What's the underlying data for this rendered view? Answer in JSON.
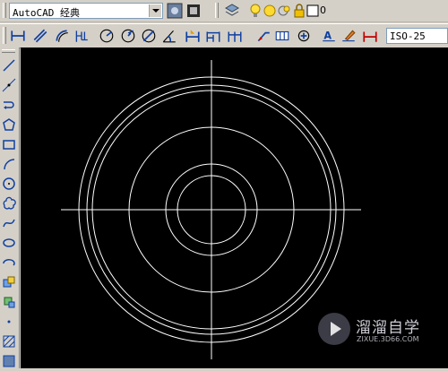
{
  "toolbar_top": {
    "workspace_value": "AutoCAD 经典",
    "layer_value": "0"
  },
  "toolbar_dim": {
    "dimstyle_value": "ISO-25"
  },
  "drawing": {
    "background": "#000000",
    "line_color": "#ffffff",
    "circle_count": 6,
    "objects": [
      "horizontal-centerline",
      "vertical-centerline",
      "circle-1",
      "circle-2",
      "circle-3",
      "circle-4",
      "circle-5",
      "circle-6"
    ]
  },
  "watermark": {
    "title": "溜溜自学",
    "site": "ZIXUE.3D66.COM"
  },
  "icons": {
    "draw_tools": [
      "line-icon",
      "construction-line-icon",
      "polyline-icon",
      "polygon-icon",
      "rectangle-icon",
      "arc-icon",
      "circle-icon",
      "revision-cloud-icon",
      "spline-icon",
      "ellipse-icon",
      "ellipse-arc-icon",
      "insert-block-icon",
      "make-block-icon",
      "point-icon",
      "hatch-icon",
      "gradient-icon"
    ],
    "dim_tools": [
      "linear-dim-icon",
      "aligned-dim-icon",
      "arc-length-icon",
      "ordinate-dim-icon",
      "radius-dim-icon",
      "jogged-dim-icon",
      "diameter-dim-icon",
      "angular-dim-icon",
      "quick-dim-icon",
      "baseline-dim-icon",
      "continue-dim-icon",
      "quick-leader-icon",
      "tolerance-icon",
      "center-mark-icon",
      "dim-edit-icon",
      "dim-text-edit-icon",
      "dim-update-icon"
    ]
  }
}
